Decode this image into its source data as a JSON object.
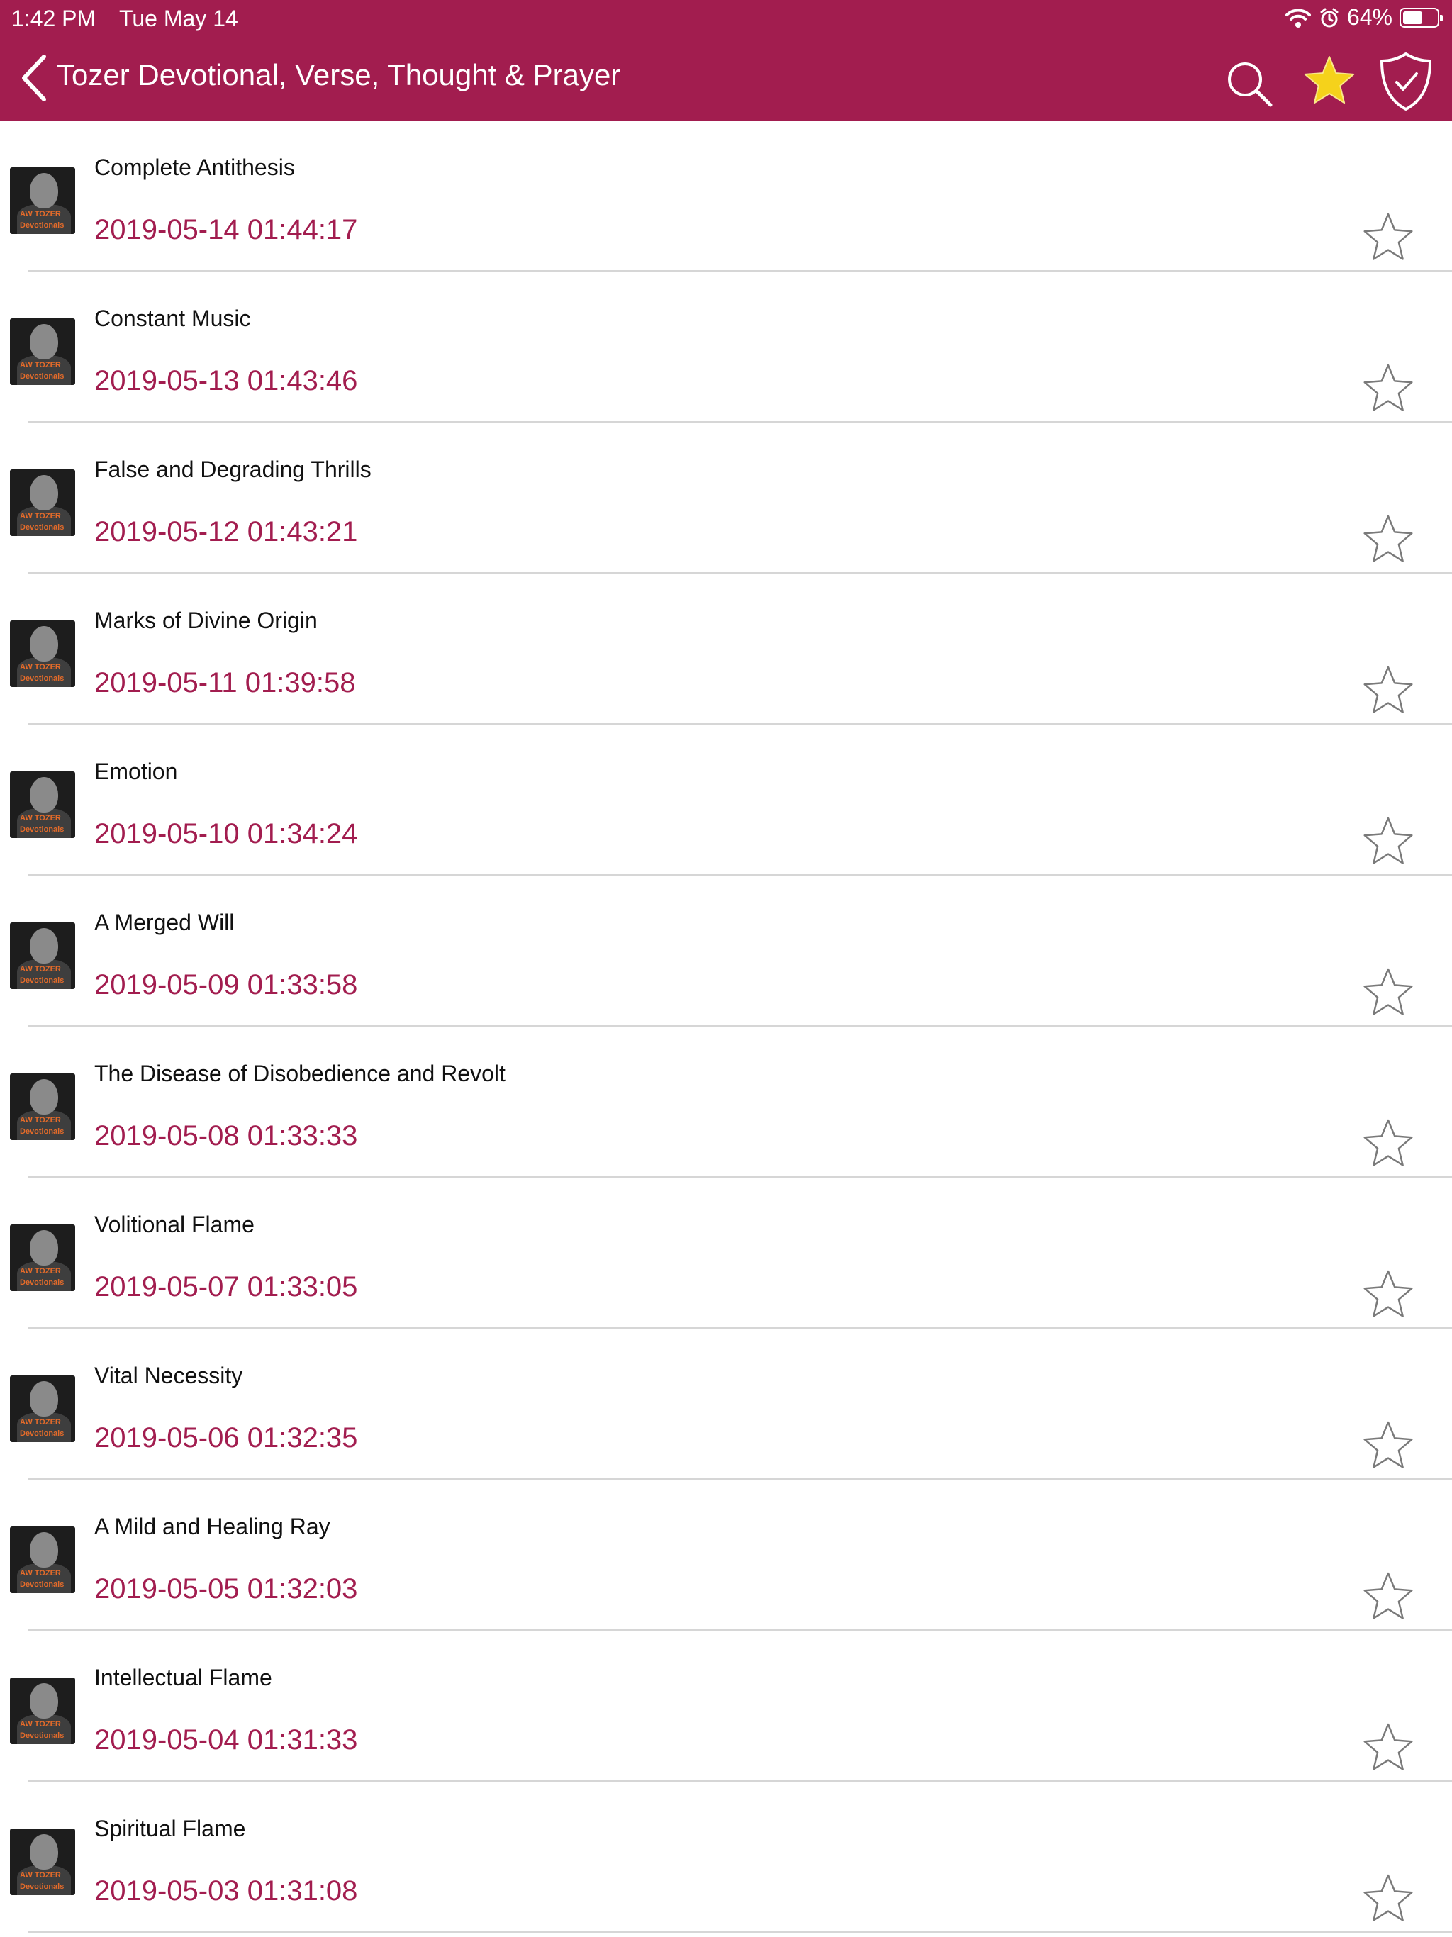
{
  "status_bar": {
    "time": "1:42 PM",
    "date": "Tue May 14",
    "battery": "64%",
    "battery_level": 0.64,
    "icons": [
      "wifi-icon",
      "alarm-icon",
      "battery-icon"
    ]
  },
  "nav": {
    "title": "Tozer Devotional, Verse, Thought & Prayer",
    "back_icon": "chevron-left-icon",
    "actions": [
      "search-icon",
      "star-filled-icon",
      "shield-check-icon"
    ]
  },
  "thumbnail": {
    "line1": "AW TOZER",
    "line2": "Devotionals"
  },
  "items": [
    {
      "title": "Complete Antithesis",
      "timestamp": "2019-05-14 01:44:17",
      "favorited": false
    },
    {
      "title": "Constant Music",
      "timestamp": "2019-05-13 01:43:46",
      "favorited": false
    },
    {
      "title": "False and Degrading Thrills",
      "timestamp": "2019-05-12 01:43:21",
      "favorited": false
    },
    {
      "title": "Marks of Divine Origin",
      "timestamp": "2019-05-11 01:39:58",
      "favorited": false
    },
    {
      "title": "Emotion",
      "timestamp": "2019-05-10 01:34:24",
      "favorited": false
    },
    {
      "title": "A Merged Will",
      "timestamp": "2019-05-09 01:33:58",
      "favorited": false
    },
    {
      "title": "The Disease of Disobedience and Revolt",
      "timestamp": "2019-05-08 01:33:33",
      "favorited": false
    },
    {
      "title": "Volitional Flame",
      "timestamp": "2019-05-07 01:33:05",
      "favorited": false
    },
    {
      "title": "Vital Necessity",
      "timestamp": "2019-05-06 01:32:35",
      "favorited": false
    },
    {
      "title": "A Mild and Healing Ray",
      "timestamp": "2019-05-05 01:32:03",
      "favorited": false
    },
    {
      "title": "Intellectual Flame",
      "timestamp": "2019-05-04 01:31:33",
      "favorited": false
    },
    {
      "title": "Spiritual Flame",
      "timestamp": "2019-05-03 01:31:08",
      "favorited": false
    }
  ],
  "colors": {
    "accent": "#a21d4f",
    "star_fill": "#f5d21b",
    "divider": "#d6d6d6"
  }
}
